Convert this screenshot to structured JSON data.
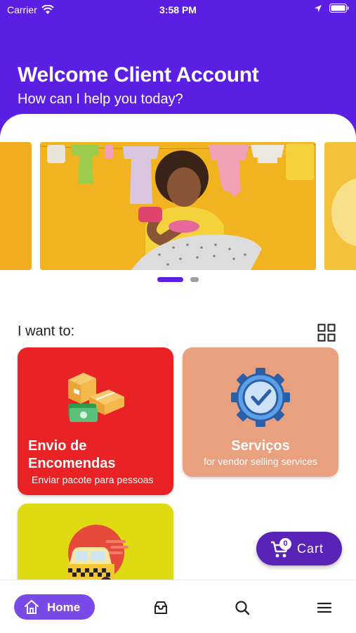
{
  "status_bar": {
    "carrier": "Carrier",
    "time": "3:58 PM",
    "icons": [
      "wifi-icon",
      "location-arrow-icon",
      "battery-icon"
    ]
  },
  "header": {
    "title": "Welcome Client Account",
    "subtitle": "How can I help you today?",
    "background_color": "#5b1ee3"
  },
  "carousel": {
    "slides": 3,
    "active_index": 0,
    "indicator_count": 2
  },
  "section": {
    "label": "I want to:",
    "view_icon": "grid-icon"
  },
  "cards": [
    {
      "title_line1": "Envio de",
      "title_line2": "Encomendas",
      "subtitle": "Enviar pacote para pessoas",
      "color": "#e92225",
      "icon": "packages-money-icon"
    },
    {
      "title": "Serviços",
      "subtitle": "for vendor selling services",
      "color": "#e8a07e",
      "icon": "gear-check-icon"
    },
    {
      "color": "#dfdb12",
      "icon": "taxi-icon"
    }
  ],
  "cart": {
    "label": "Cart",
    "count": "0",
    "icon": "cart-icon"
  },
  "bottom_nav": {
    "home_label": "Home",
    "items": [
      "home-icon",
      "inbox-icon",
      "search-icon",
      "menu-icon"
    ],
    "accent": "#7a4ae8"
  }
}
